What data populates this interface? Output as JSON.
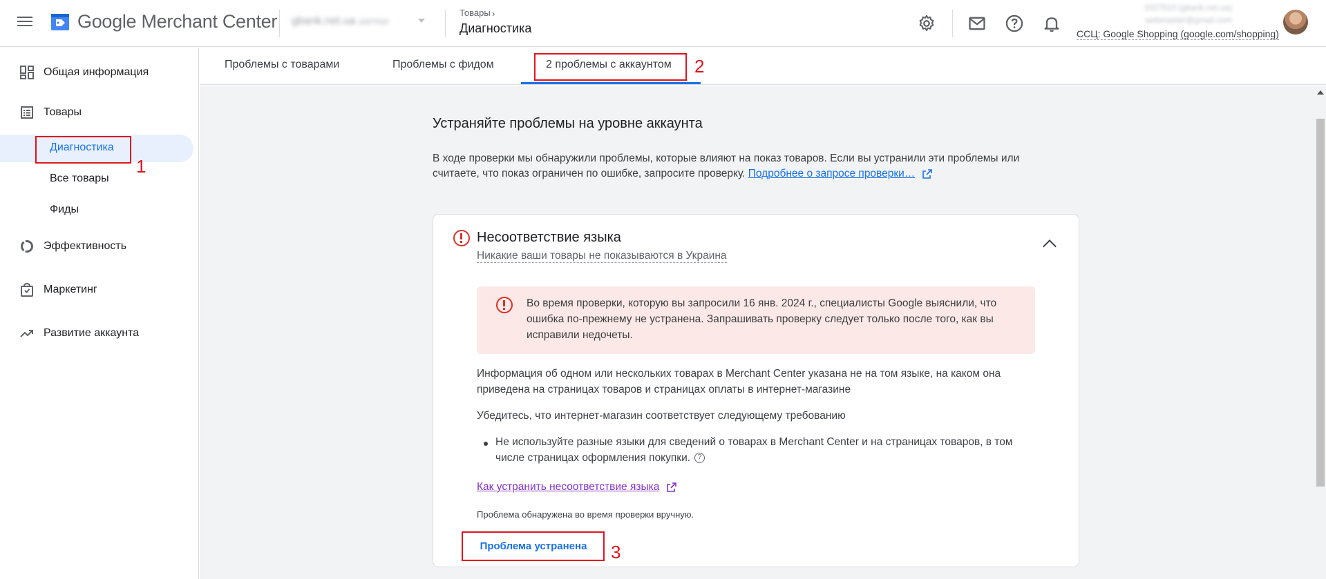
{
  "app": {
    "name": "Google Merchant Center",
    "account": "gbank.net.ua",
    "account_id": "1027010"
  },
  "breadcrumb": {
    "parent": "Товары",
    "current": "Диагностика"
  },
  "user": {
    "email_line1": "1027010 (gbank.net.ua)",
    "email_line2": "webmaster@gmail.com",
    "csc": "ССЦ: Google Shopping (google.com/shopping)"
  },
  "sidebar": {
    "items": [
      {
        "label": "Общая информация",
        "icon": "dashboard-icon"
      },
      {
        "label": "Товары",
        "icon": "list-icon"
      },
      {
        "label": "Эффективность",
        "icon": "donut-chart-icon"
      },
      {
        "label": "Маркетинг",
        "icon": "shopping-bag-icon"
      },
      {
        "label": "Развитие аккаунта",
        "icon": "trending-up-icon"
      }
    ],
    "sub_items": [
      {
        "label": "Диагностика",
        "active": true
      },
      {
        "label": "Все товары",
        "active": false
      },
      {
        "label": "Фиды",
        "active": false
      }
    ]
  },
  "tabs": [
    {
      "label": "Проблемы с товарами",
      "active": false
    },
    {
      "label": "Проблемы с фидом",
      "active": false
    },
    {
      "label": "2 проблемы с аккаунтом",
      "active": true
    }
  ],
  "section": {
    "title": "Устраняйте проблемы на уровне аккаунта",
    "description": "В ходе проверки мы обнаружили проблемы, которые влияют на показ товаров. Если вы устранили эти проблемы или считаете, что показ ограничен по ошибке, запросите проверку.",
    "link": "Подробнее о запросе проверки…"
  },
  "issue": {
    "title": "Несоответствие языка",
    "subtitle": "Никакие ваши товары не показываются в Украина",
    "alert": "Во время проверки, которую вы запросили 16 янв. 2024 г., специалисты Google выяснили, что ошибка по-прежнему не устранена. Запрашивать проверку следует только после того, как вы исправили недочеты.",
    "info": "Информация об одном или нескольких товарах в Merchant Center указана не на том языке, на каком она приведена на страницах товаров и страницах оплаты в интернет-магазине",
    "requirement_intro": "Убедитесь, что интернет-магазин соответствует следующему требованию",
    "requirement": "Не используйте разные языки для сведений о товарах в Merchant Center и на страницах товаров, в том числе страницах оформления покупки.",
    "howto_link": "Как устранить несоответствие языка",
    "note": "Проблема обнаружена во время проверки вручную.",
    "fixed_button": "Проблема устранена"
  },
  "annotations": [
    "1",
    "2",
    "3"
  ],
  "colors": {
    "accent": "#1a73e8",
    "error": "#d93025",
    "annotation": "#e0141e",
    "alert_bg": "#fce8e6"
  }
}
